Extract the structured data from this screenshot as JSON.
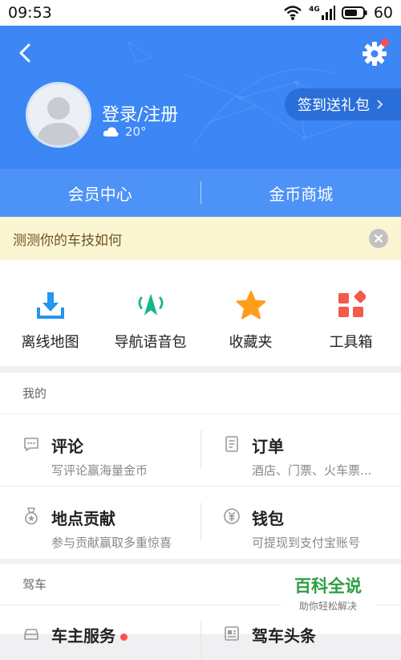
{
  "status_bar": {
    "time": "09:53",
    "network": "4G",
    "battery": "60"
  },
  "header": {
    "login_text": "登录/注册",
    "weather": "20°",
    "signin_button": "签到送礼包",
    "member_center": "会员中心",
    "coin_mall": "金币商城",
    "colors": {
      "primary": "#3c86f5",
      "badge": "#ff4d4f"
    }
  },
  "banner": {
    "text": "测测你的车技如何"
  },
  "tools": [
    {
      "label": "离线地图",
      "icon": "download-icon",
      "color": "#2196f3"
    },
    {
      "label": "导航语音包",
      "icon": "navigation-voice-icon",
      "color": "#16b48c"
    },
    {
      "label": "收藏夹",
      "icon": "star-icon",
      "color": "#ff9e1a"
    },
    {
      "label": "工具箱",
      "icon": "toolbox-icon",
      "color": "#f25a4a"
    }
  ],
  "my_section": {
    "title": "我的",
    "items": [
      {
        "title": "评论",
        "subtitle": "写评论赢海量金币",
        "icon": "comment-icon"
      },
      {
        "title": "订单",
        "subtitle": "酒店、门票、火车票...",
        "icon": "order-icon"
      },
      {
        "title": "地点贡献",
        "subtitle": "参与贡献赢取多重惊喜",
        "icon": "medal-icon"
      },
      {
        "title": "钱包",
        "subtitle": "可提现到支付宝账号",
        "icon": "wallet-icon"
      }
    ]
  },
  "drive_section": {
    "title": "驾车",
    "items": [
      {
        "title": "车主服务",
        "icon": "car-icon"
      },
      {
        "title": "驾车头条",
        "icon": "news-icon"
      }
    ]
  },
  "watermark": {
    "title": "百科全说",
    "subtitle": "助你轻松解决"
  }
}
